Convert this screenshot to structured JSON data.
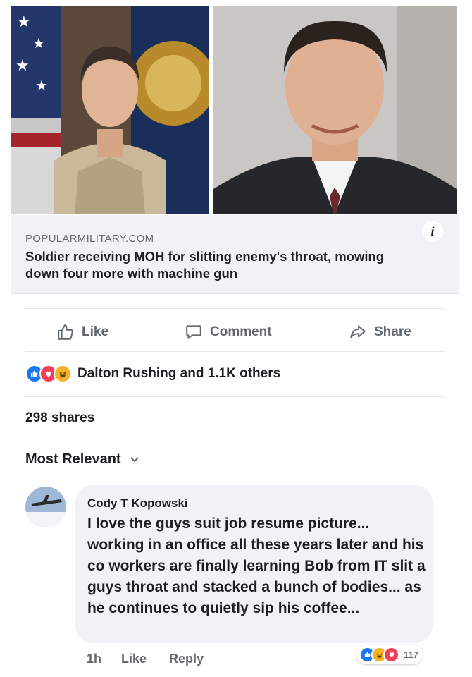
{
  "link_preview": {
    "domain": "POPULARMILITARY.COM",
    "headline": "Soldier receiving MOH for slitting enemy's throat, mowing down four more with machine gun",
    "info_glyph": "i",
    "images": [
      "soldier-portrait",
      "man-in-suit-portrait"
    ]
  },
  "actions": {
    "like": "Like",
    "comment": "Comment",
    "share": "Share"
  },
  "reactions": {
    "icons": [
      "like-icon",
      "love-icon",
      "haha-icon"
    ],
    "summary": "Dalton Rushing and 1.1K others"
  },
  "shares_text": "298 shares",
  "comment_sort": "Most Relevant",
  "comment": {
    "author": "Cody T Kopowski",
    "text": "I love the guys suit job resume picture... working in an office all these years later and his co workers are finally learning Bob from IT slit a guys throat and stacked a bunch of bodies... as he continues to quietly sip his coffee...",
    "time": "1h",
    "like_label": "Like",
    "reply_label": "Reply",
    "reaction_count": "117"
  },
  "colors": {
    "accent": "#1877f2",
    "link_box_bg": "#f0f2f5",
    "secondary_text": "#65676b"
  }
}
